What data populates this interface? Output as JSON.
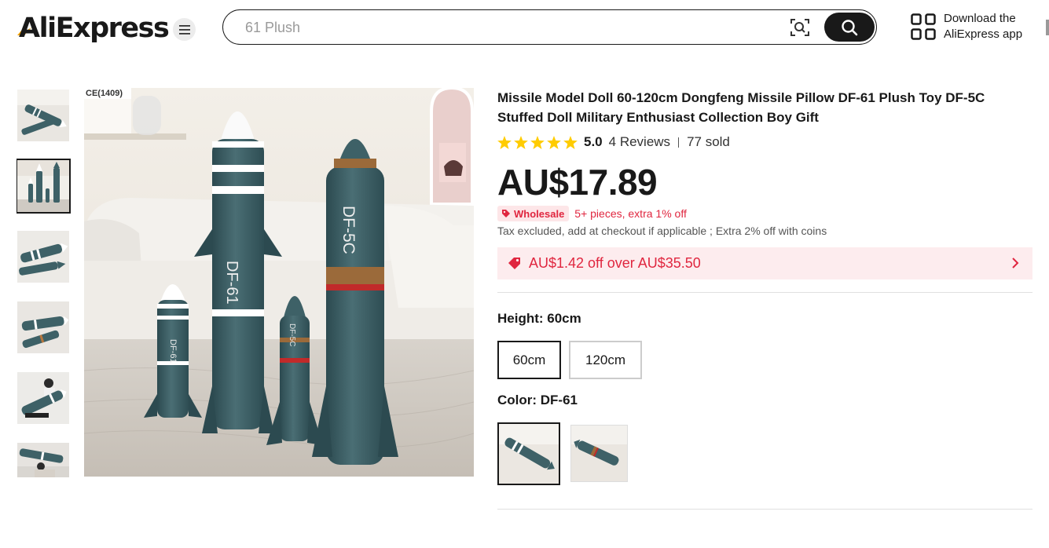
{
  "header": {
    "logo_text": "AliExpress",
    "search_placeholder": "61 Plush",
    "app_download_line1": "Download the",
    "app_download_line2": "AliExpress app"
  },
  "gallery": {
    "thumbnail_count": 6,
    "active_index": 1
  },
  "product": {
    "title": "Missile Model Doll 60-120cm Dongfeng Missile Pillow DF-61 Plush Toy DF-5C Stuffed Doll Military Enthusiast Collection Boy Gift",
    "rating": "5.0",
    "star_count": 5,
    "reviews": "4 Reviews",
    "sold": "77 sold",
    "price": "AU$17.89",
    "wholesale_label": "Wholesale",
    "wholesale_text": "5+ pieces, extra 1% off",
    "tax_note": "Tax excluded, add at checkout if applicable ; Extra 2% off with coins",
    "coupon_text": "AU$1.42 off over AU$35.50",
    "height_label": "Height: 60cm",
    "sizes": [
      "60cm",
      "120cm"
    ],
    "selected_size": "60cm",
    "color_label": "Color: DF-61",
    "selected_color_index": 0
  },
  "main_image": {
    "text_sign": "CE(1409)",
    "labels": [
      "DF-61",
      "DF-61",
      "DF-5C",
      "DF-5C"
    ]
  },
  "colors": {
    "accent_red": "#e0263f",
    "coupon_bg": "#fdecee",
    "star": "#ffcc00",
    "dark": "#191919",
    "missile_teal": "#3e6167"
  }
}
